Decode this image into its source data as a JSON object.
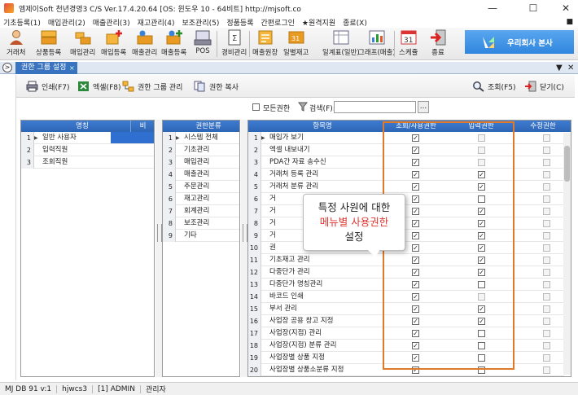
{
  "window": {
    "title": "엠제이Soft 천년경영3 C/S  Ver.17.4.20.64  [OS: 윈도우 10 - 64비트]  http://mjsoft.co",
    "controls": [
      "—",
      "☐",
      "✕"
    ]
  },
  "menu": {
    "items": [
      "기초등록(1)",
      "매입관리(2)",
      "매출관리(3)",
      "재고관리(4)",
      "보조관리(5)",
      "정품등록",
      "간편로그인",
      "★원격지원",
      "종료(X)"
    ],
    "right": "■"
  },
  "toolbar": {
    "buttons": [
      {
        "label": "거래처",
        "icon": "person-icon"
      },
      {
        "label": "상품등록",
        "icon": "boxes-icon"
      },
      {
        "label": "매입관리",
        "icon": "purchase-icon"
      },
      {
        "label": "매입등록",
        "icon": "purchase-add-icon"
      },
      {
        "label": "매출관리",
        "icon": "sales-icon"
      },
      {
        "label": "매출등록",
        "icon": "sales-add-icon"
      },
      {
        "label": "POS",
        "icon": "pos-icon"
      },
      {
        "label": "경비관리",
        "icon": "expense-icon"
      },
      {
        "label": "매출원장",
        "icon": "ledger-icon"
      },
      {
        "label": "일별재고",
        "icon": "stock-icon"
      },
      {
        "label": "일계표(일반)",
        "icon": "report-icon"
      },
      {
        "label": "그래프(매출)",
        "icon": "chart-icon"
      },
      {
        "label": "스케쥴",
        "icon": "calendar-icon"
      },
      {
        "label": "종료",
        "icon": "exit-icon"
      }
    ],
    "brand": "우리회사 본사",
    "calendar_day": "31"
  },
  "tabs": {
    "active": "권한 그룹 설정",
    "close": "×",
    "nav": ">",
    "right_controls": [
      "▼",
      "✕"
    ]
  },
  "actions": {
    "print": "인쇄(F7)",
    "excel": "엑셀(F8)",
    "group_manage": "권한 그룹 관리",
    "copy": "권한 복사",
    "search": "조회(F5)",
    "close": "닫기(C)"
  },
  "filter": {
    "all_perm": "모든권한",
    "search_label": "검색(F):",
    "search_value": "",
    "browse": "..."
  },
  "group_grid": {
    "headers": [
      "명칭",
      "비"
    ],
    "rows": [
      {
        "no": "1",
        "name": "일반 사용자"
      },
      {
        "no": "2",
        "name": "입력직원"
      },
      {
        "no": "3",
        "name": "조회직원"
      }
    ]
  },
  "category_grid": {
    "headers": [
      "권한분류"
    ],
    "rows": [
      {
        "no": "1",
        "name": "시스템 전체"
      },
      {
        "no": "2",
        "name": "기초관리"
      },
      {
        "no": "3",
        "name": "매입관리"
      },
      {
        "no": "4",
        "name": "매출관리"
      },
      {
        "no": "5",
        "name": "주문관리"
      },
      {
        "no": "6",
        "name": "재고관리"
      },
      {
        "no": "7",
        "name": "회계관리"
      },
      {
        "no": "8",
        "name": "보조관리"
      },
      {
        "no": "9",
        "name": "기타"
      }
    ]
  },
  "perm_grid": {
    "headers": [
      "항목명",
      "조회/사용권한",
      "입력권한",
      "수정권한"
    ],
    "rows": [
      {
        "no": "1",
        "name": "매입가 보기",
        "view": true,
        "input": false,
        "input_enabled": false
      },
      {
        "no": "2",
        "name": "엑셀 내보내기",
        "view": true,
        "input": false,
        "input_enabled": false
      },
      {
        "no": "3",
        "name": "PDA간 자료 송수신",
        "view": true,
        "input": false,
        "input_enabled": false
      },
      {
        "no": "4",
        "name": "거래처 등록 관리",
        "view": true,
        "input": true,
        "input_enabled": true
      },
      {
        "no": "5",
        "name": "거래처 분류 관리",
        "view": true,
        "input": true,
        "input_enabled": true
      },
      {
        "no": "6",
        "name": "거",
        "view": true,
        "input": false,
        "input_enabled": true
      },
      {
        "no": "7",
        "name": "거",
        "view": true,
        "input": true,
        "input_enabled": true
      },
      {
        "no": "8",
        "name": "거",
        "view": true,
        "input": true,
        "input_enabled": true
      },
      {
        "no": "9",
        "name": "거",
        "view": true,
        "input": true,
        "input_enabled": true
      },
      {
        "no": "10",
        "name": "권",
        "view": true,
        "input": true,
        "input_enabled": true
      },
      {
        "no": "11",
        "name": "기초재고 관리",
        "view": true,
        "input": true,
        "input_enabled": true
      },
      {
        "no": "12",
        "name": "다중단가 관리",
        "view": true,
        "input": true,
        "input_enabled": true
      },
      {
        "no": "13",
        "name": "다중단가 명칭관리",
        "view": true,
        "input": false,
        "input_enabled": true
      },
      {
        "no": "14",
        "name": "바코드 인쇄",
        "view": true,
        "input": false,
        "input_enabled": false
      },
      {
        "no": "15",
        "name": "부서 관리",
        "view": true,
        "input": true,
        "input_enabled": true
      },
      {
        "no": "16",
        "name": "사업장 공용 창고 지정",
        "view": true,
        "input": true,
        "input_enabled": true
      },
      {
        "no": "17",
        "name": "사업장(지점) 관리",
        "view": true,
        "input": false,
        "input_enabled": true
      },
      {
        "no": "18",
        "name": "사업장(지점) 분류 관리",
        "view": true,
        "input": false,
        "input_enabled": true
      },
      {
        "no": "19",
        "name": "사업장별 상품 지정",
        "view": true,
        "input": false,
        "input_enabled": true
      },
      {
        "no": "20",
        "name": "사업장별 상품소분류 지정",
        "view": true,
        "input": false,
        "input_enabled": true
      }
    ]
  },
  "callout": {
    "line1": "특정 사원에 대한",
    "line2": "메뉴별 사용권한",
    "line3": "설정"
  },
  "status": [
    "MJ DB 91 v:1",
    "hjwcs3",
    "[1] ADMIN",
    "관리자"
  ],
  "colors": {
    "header_blue": "#2e66b5",
    "tab_blue": "#3a73c0",
    "highlight_orange": "#e07a2a",
    "callout_red": "#e03530",
    "brand_blue": "#2f86de"
  }
}
